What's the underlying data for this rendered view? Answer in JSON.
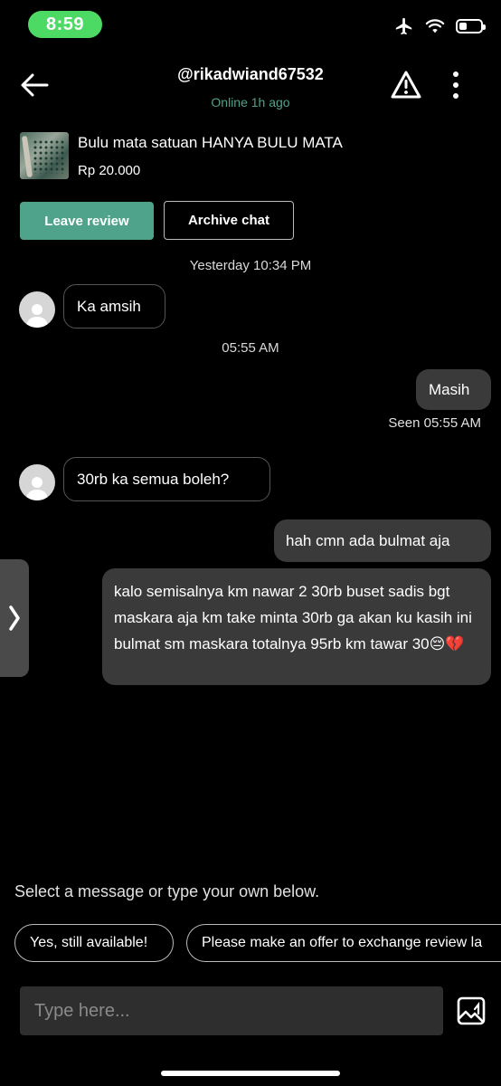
{
  "status_bar": {
    "time": "8:59"
  },
  "header": {
    "username": "@rikadwiand67532",
    "online_status": "Online 1h ago"
  },
  "product": {
    "title": "Bulu mata satuan HANYA BULU MATA",
    "price": "Rp 20.000"
  },
  "actions": {
    "leave_review": "Leave review",
    "archive_chat": "Archive chat"
  },
  "messages": {
    "ts1": "Yesterday 10:34 PM",
    "in1": "Ka amsih",
    "ts2": "05:55 AM",
    "out1": "Masih",
    "seen": "Seen 05:55 AM",
    "in2": "30rb ka semua boleh?",
    "out2": "hah cmn ada bulmat aja",
    "out3": "kalo semisalnya km nawar 2 30rb buset sadis bgt maskara aja km take minta 30rb ga akan ku kasih ini bulmat sm maskara totalnya 95rb km tawar 30😔💔"
  },
  "quick_replies": {
    "hint": "Select a message or type your own below.",
    "chip1": "Yes, still available!",
    "chip2": "Please make an offer to exchange review la"
  },
  "composer": {
    "placeholder": "Type here..."
  },
  "colors": {
    "accent": "#4fa38a",
    "status_pill": "#4cd964",
    "outgoing_bubble": "#3a3a3a"
  }
}
